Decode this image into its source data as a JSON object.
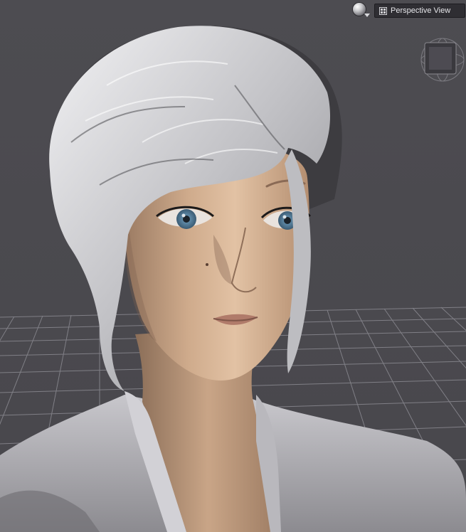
{
  "viewport": {
    "view_menu": {
      "label": "Perspective View",
      "icon": "viewport-layout-icon"
    },
    "render_button": {
      "icon": "render-sphere-icon"
    },
    "orientation_cube": {
      "icon": "orientation-cube-icon"
    }
  },
  "colors": {
    "background": "#4b4a4f",
    "grid_line": "#8a8990",
    "hair": "#c9c9cd",
    "skin": "#c7a384",
    "shirt": "#a3a2a7",
    "iris": "#5f8aa8"
  }
}
